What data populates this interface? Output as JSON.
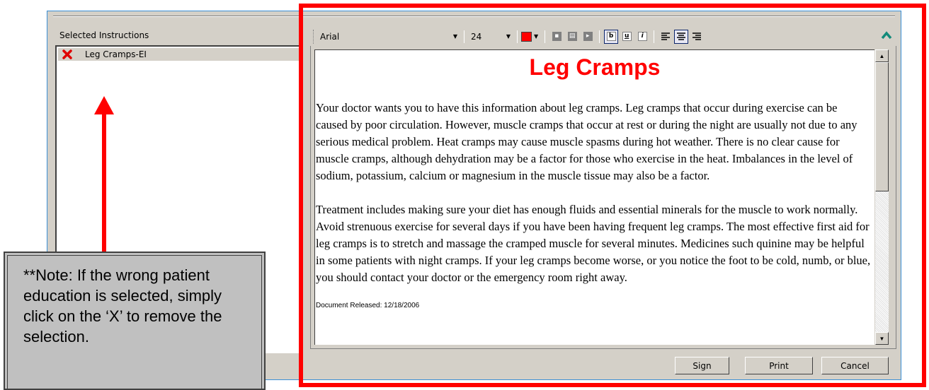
{
  "selected_instructions": {
    "label": "Selected Instructions",
    "items": [
      {
        "label": "Leg Cramps-EI",
        "remove_icon": "red-x-icon"
      }
    ]
  },
  "toolbar": {
    "font": "Arial",
    "size": "24",
    "color": "#ff0000",
    "buttons": [
      "image-icon",
      "table-icon",
      "indent-icon",
      "bold-icon",
      "underline-icon",
      "italic-icon",
      "align-left-icon",
      "align-center-icon",
      "align-right-icon"
    ],
    "bold_glyph": "b",
    "underline_glyph": "u",
    "italic_glyph": "i"
  },
  "document": {
    "title": "Leg Cramps",
    "paragraphs": [
      "Your doctor wants you to have this information about leg cramps.  Leg cramps that occur during exercise can be caused by poor circulation.  However, muscle cramps that occur at rest or during the night are usually not due to any serious medical problem.  Heat cramps may cause muscle spasms during hot weather. There is no clear cause for muscle cramps, although dehydration may be a factor for those who exercise in the heat.  Imbalances in the level of sodium, potassium, calcium or magnesium in the muscle tissue may also be a factor.",
      "Treatment includes making sure your diet has enough fluids and essential minerals for the muscle to work normally.  Avoid strenuous exercise for several days if you have been having frequent leg cramps.  The most effective first aid for leg cramps is to stretch and massage the cramped muscle for several minutes.  Medicines such quinine may be helpful in some patients with night cramps.  If your leg cramps become worse, or you notice the foot to be cold, numb, or blue, you should contact your doctor or the emergency room right away."
    ],
    "released": "Document Released: 12/18/2006"
  },
  "buttons": {
    "sign": "Sign",
    "print": "Print",
    "cancel": "Cancel"
  },
  "annotation": {
    "note": "**Note: If the wrong patient education is selected, simply click on the ‘X’ to remove the selection.",
    "color": "#ff0000"
  }
}
